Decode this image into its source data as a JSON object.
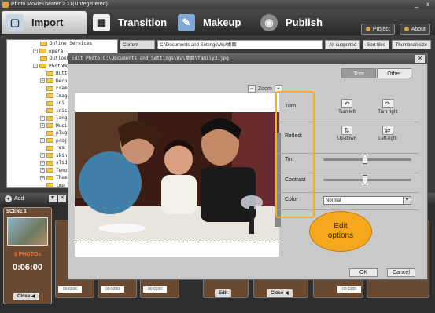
{
  "window": {
    "title": "Photo MovieTheater 2.11(Unregistered)",
    "min": "_",
    "close": "x"
  },
  "tabs": [
    {
      "label": "Import",
      "icon": "import-icon"
    },
    {
      "label": "Transition",
      "icon": "transition-icon"
    },
    {
      "label": "Makeup",
      "icon": "makeup-icon"
    },
    {
      "label": "Publish",
      "icon": "publish-icon"
    }
  ],
  "topright": {
    "project": "Project",
    "about": "About"
  },
  "tree": {
    "items": [
      "Online Services",
      "opera",
      "Outlook",
      "PhotoMov",
      "Butto",
      "Decor",
      "Frame",
      "Image",
      "ini",
      "inis",
      "langu",
      "Music",
      "plugi",
      "proje",
      "res",
      "skin",
      "slide",
      "Templ",
      "Theme",
      "tmp"
    ]
  },
  "folderbar": {
    "label": "Current Folder",
    "path": "C:\\Documents and Settings\\Wu\\桌面",
    "all_supported": "All supported",
    "sort_files": "Sort files",
    "thumbnail_size": "Thumbnail size"
  },
  "bottombar": {
    "add": "Add"
  },
  "storyboard": {
    "scene_title": "SCENE 1",
    "photo_count": "3 PHOTOs",
    "scene_time": "0:06:00",
    "close": "Close",
    "edit": "Edit",
    "slot_nums": [
      "00:0200",
      "00:0200",
      "00:0200",
      "00:0200",
      "00:0200",
      "00:2200"
    ]
  },
  "dialog": {
    "title": "Edit Photo:C:\\Documents and Settings\\Wu\\桌面\\family3.jpg",
    "trim": "Trim",
    "other": "Other",
    "zoom": "Zoom",
    "zoom_out": "−",
    "zoom_in": "+",
    "turn": "Turn",
    "turn_left": "Turn left",
    "turn_right": "Turn right",
    "reflect": "Reflect",
    "up_down": "Up-down",
    "left_right": "Left-right",
    "tint": "Tint",
    "contrast": "Contrast",
    "color": "Color",
    "color_value": "Normal",
    "ok": "OK",
    "cancel": "Cancel",
    "tint_level": 0.47,
    "contrast_level": 0.47
  },
  "callout": {
    "line1": "Edit",
    "line2": "options"
  }
}
